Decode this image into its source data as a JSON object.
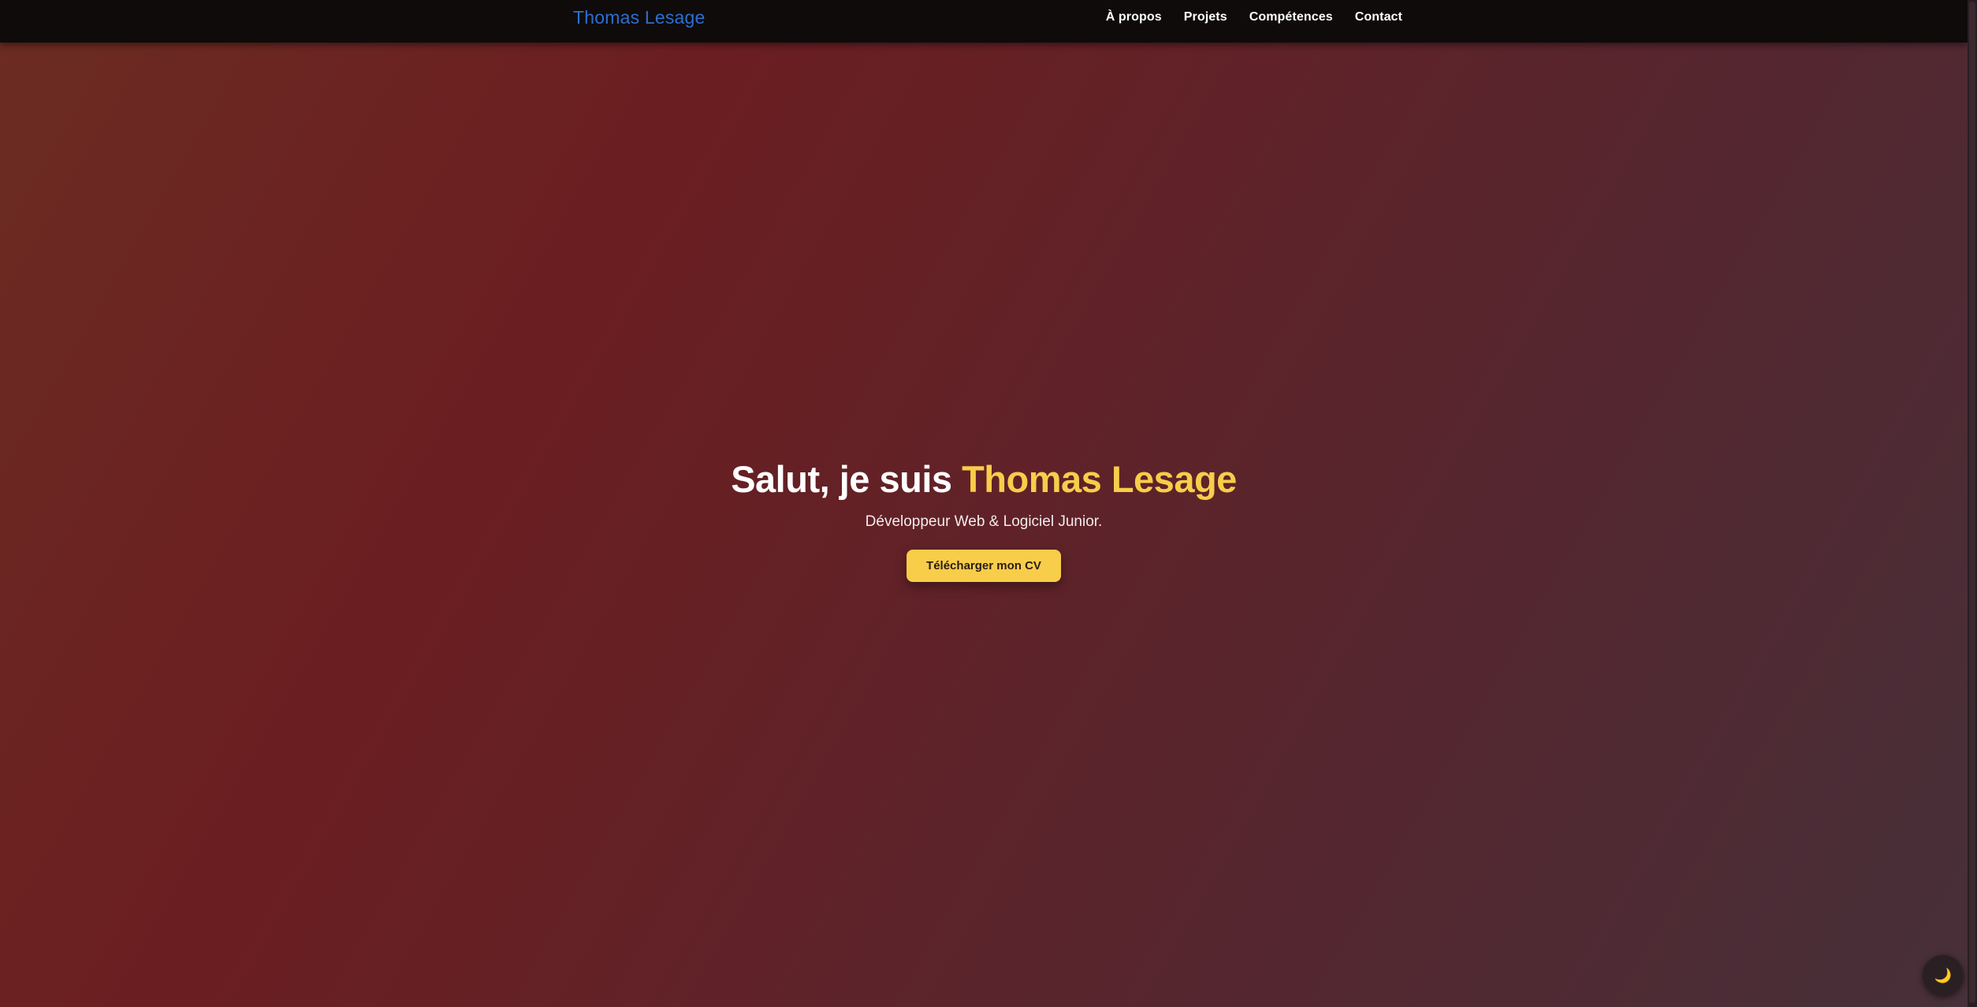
{
  "header": {
    "brand": "Thomas Lesage",
    "nav": [
      {
        "label": "À propos"
      },
      {
        "label": "Projets"
      },
      {
        "label": "Compétences"
      },
      {
        "label": "Contact"
      }
    ]
  },
  "hero": {
    "greeting": "Salut, je suis ",
    "name": "Thomas Lesage",
    "subtitle": "Développeur Web & Logiciel Junior.",
    "cta_label": "Télécharger mon CV"
  },
  "theme_toggle": {
    "icon": "moon-icon",
    "glyph": "🌙"
  },
  "colors": {
    "brand": "#2b6fd0",
    "accent": "#f8cd4a",
    "nav_bg": "#0f0b0b"
  }
}
